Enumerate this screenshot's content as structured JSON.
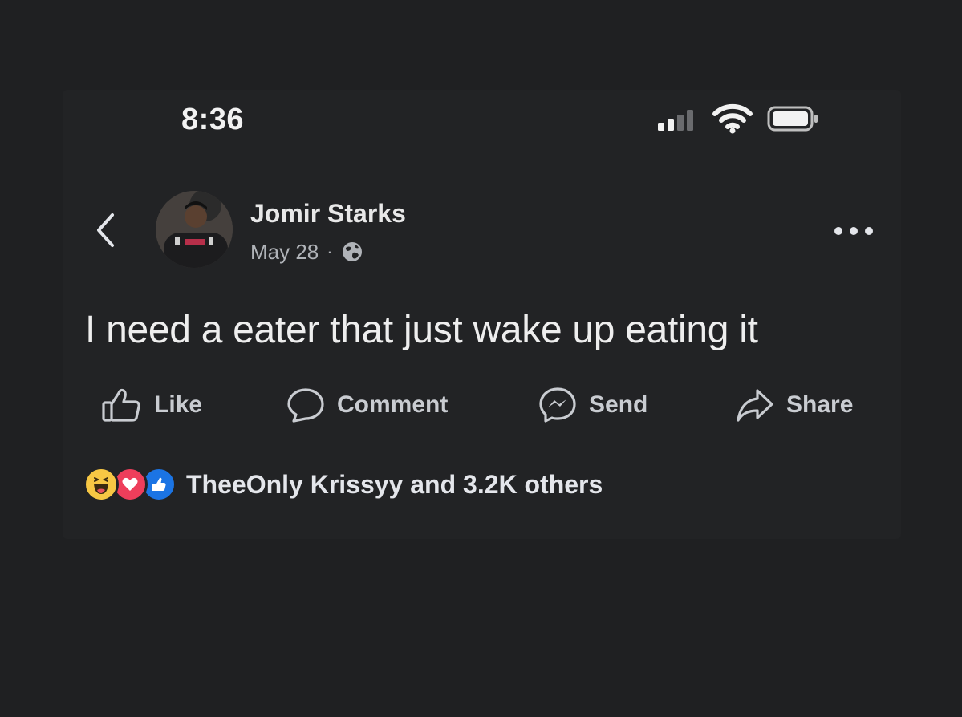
{
  "status_bar": {
    "time": "8:36",
    "icons": [
      "signal-icon",
      "wifi-icon",
      "battery-icon"
    ]
  },
  "post": {
    "author": "Jomir Starks",
    "date": "May 28",
    "separator": "·",
    "privacy_icon": "globe-icon",
    "text": "I need a eater that just wake up eating it"
  },
  "actions": {
    "like_label": "Like",
    "comment_label": "Comment",
    "send_label": "Send",
    "share_label": "Share"
  },
  "reactions": {
    "icons": [
      "haha-icon",
      "love-icon",
      "like-icon"
    ],
    "summary": "TheeOnly Krissyy and 3.2K others"
  },
  "colors": {
    "background": "#1f2022",
    "text_primary": "#e4e6eb",
    "text_secondary": "#b0b3b8",
    "like_blue": "#1b74e4",
    "love_red": "#ee3e5b",
    "haha_yellow": "#f7c744"
  }
}
